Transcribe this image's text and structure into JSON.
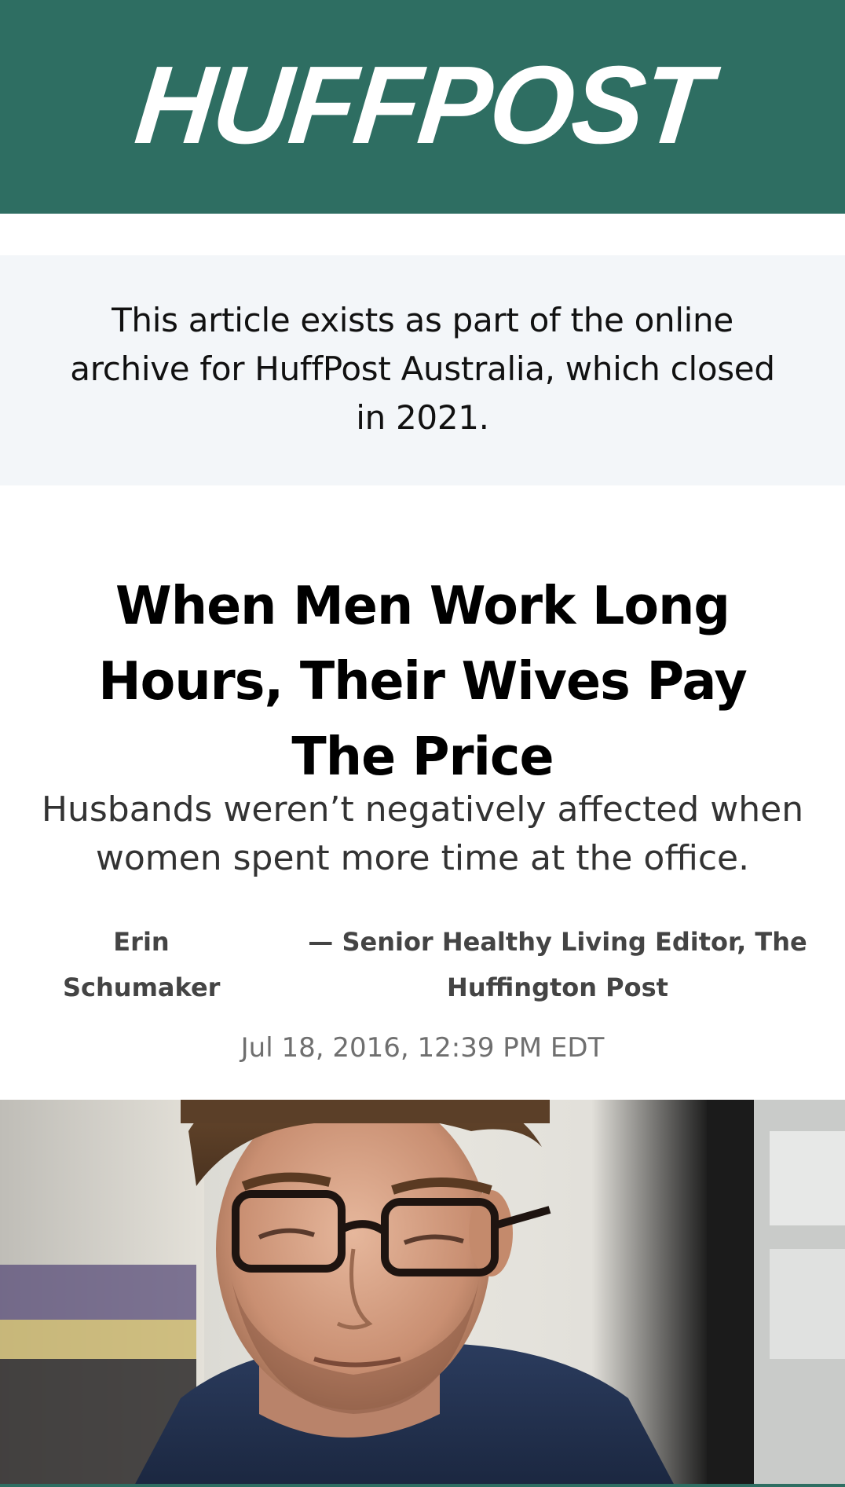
{
  "header": {
    "logo_text": "HUFFPOST",
    "background_color": "#2e6e62"
  },
  "archive_notice": {
    "text": "This article exists as part of the online archive for HuffPost Australia, which closed in 2021."
  },
  "article": {
    "headline": "When Men Work Long Hours, Their Wives Pay The Price",
    "subheadline": "Husbands weren’t negatively affected when women spent more time at the office.",
    "author_name": "Erin Schumaker",
    "author_role": "— Senior Healthy Living Editor, The Huffington Post",
    "timestamp": "Jul 18, 2016, 12:39 PM EDT",
    "hero_image_icon": "photo-man-with-glasses-icon"
  }
}
